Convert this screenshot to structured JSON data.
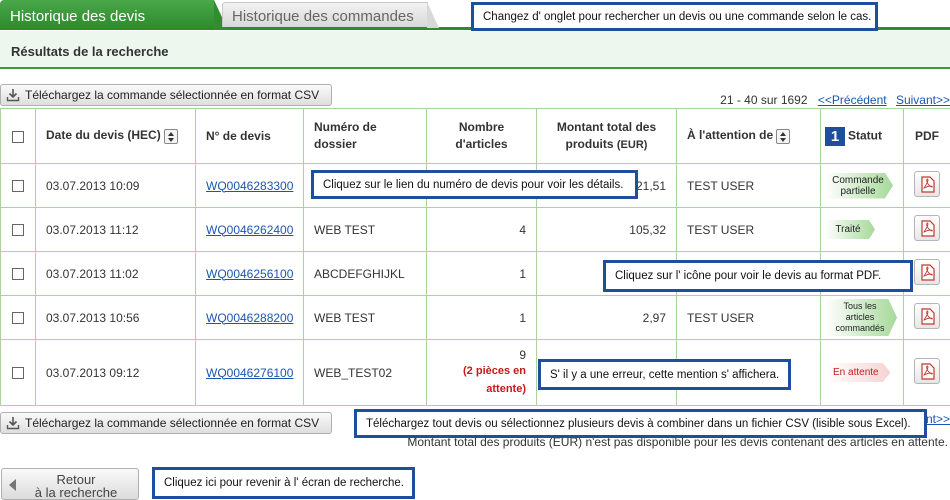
{
  "tabs": {
    "quotes_history": "Historique des devis",
    "orders_history": "Historique des commandes"
  },
  "results": {
    "title": "Résultats de la recherche"
  },
  "csv_button_label": "Téléchargez la commande sélectionnée en format CSV",
  "pagination": {
    "range": "21 - 40 sur 1692",
    "previous": "<<Précédent",
    "next": "Suivant>>",
    "next_bottom": "nt>>"
  },
  "table": {
    "headers": {
      "date": "Date du devis (HEC)",
      "quote_no": "N° de devis",
      "file_no": "Numéro de dossier",
      "articles": "Nombre d'articles",
      "amount": "Montant total des produits",
      "amount_unit": "(EUR)",
      "attention": "À l'attention de",
      "status_step": "1",
      "status": "Statut",
      "pdf": "PDF"
    },
    "rows": [
      {
        "date": "03.07.2013 10:09",
        "quote_no": "WQ0046283300",
        "file_no": "",
        "articles": "",
        "amount": "21,51",
        "attention": "TEST USER",
        "status": "Commande partielle"
      },
      {
        "date": "03.07.2013 11:12",
        "quote_no": "WQ0046262400",
        "file_no": "WEB TEST",
        "articles": "4",
        "amount": "105,32",
        "attention": "TEST USER",
        "status": "Traité"
      },
      {
        "date": "03.07.2013 11:02",
        "quote_no": "WQ0046256100",
        "file_no": "ABCDEFGHIJKL",
        "articles": "1",
        "amount": "",
        "attention": "",
        "status": ""
      },
      {
        "date": "03.07.2013 10:56",
        "quote_no": "WQ0046288200",
        "file_no": "WEB TEST",
        "articles": "1",
        "amount": "2,97",
        "attention": "TEST USER",
        "status": "Tous les articles commandés"
      },
      {
        "date": "03.07.2013 09:12",
        "quote_no": "WQ0046276100",
        "file_no": "WEB_TEST02",
        "articles": "9",
        "pending_note": "(2 pièces en attente)",
        "amount": "",
        "attention": "",
        "status": "En attente"
      }
    ]
  },
  "footnote": "Montant total des produits (EUR) n'est pas disponible pour les devis contenant des articles en attente.",
  "back_button": {
    "line1": "Retour",
    "line2": "à la recherche"
  },
  "callouts": {
    "tabs": "Changez d' onglet pour rechercher un devis ou une commande selon le cas.",
    "quote_link": "Cliquez sur le lien du numéro de devis pour voir les détails.",
    "pdf_icon": "Cliquez sur l' icône pour voir le devis au format PDF.",
    "error": "S' il y a une erreur, cette mention s' affichera.",
    "csv": "Téléchargez tout devis ou sélectionnez plusieurs devis à combiner dans un fichier CSV (lisible sous Excel).",
    "back": "Cliquez ici pour revenir à l' écran de recherche."
  }
}
